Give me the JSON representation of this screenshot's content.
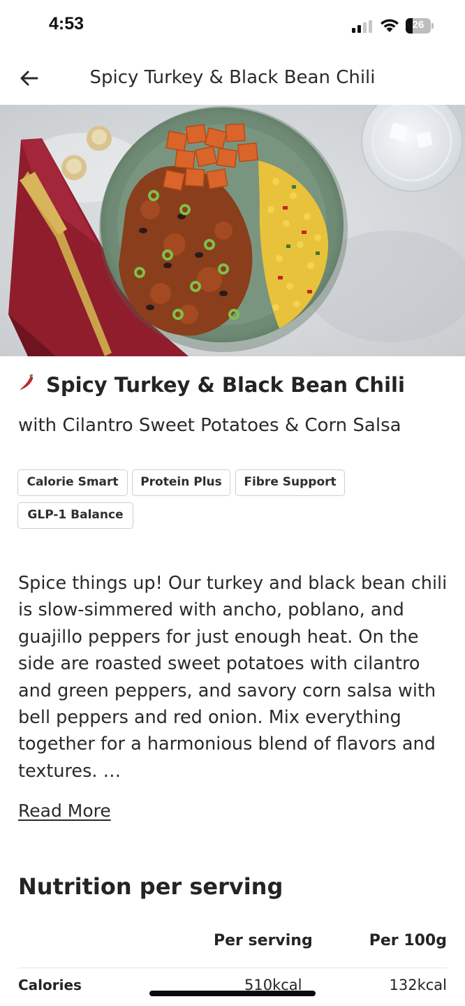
{
  "status_bar": {
    "time": "4:53",
    "battery": "26"
  },
  "header": {
    "title": "Spicy Turkey & Black Bean Chili"
  },
  "hero": {
    "alt": "Spicy Turkey & Black Bean Chili"
  },
  "recipe": {
    "title": "Spicy Turkey & Black Bean Chili",
    "subtitle": "with Cilantro Sweet Potatoes & Corn Salsa",
    "tags": [
      "Calorie Smart",
      "Protein Plus",
      "Fibre Support",
      "GLP-1 Balance"
    ],
    "description": "Spice things up! Our turkey and black bean chili is slow-simmered with ancho, poblano, and guajillo peppers for just enough heat. On the side are roasted sweet potatoes with cilantro and green peppers, and savory corn salsa with bell peppers and red onion. Mix everything together for a harmonious blend of flavors and textures. …",
    "read_more": "Read More"
  },
  "nutrition": {
    "heading": "Nutrition per serving",
    "columns": [
      "Per serving",
      "Per 100g"
    ],
    "rows": [
      {
        "label": "Calories",
        "per_serving": "510kcal",
        "per_100g": "132kcal"
      }
    ]
  },
  "colors": {
    "chili_red": "#c0282a",
    "tag_border": "#cfcfcf",
    "text": "#242424"
  }
}
